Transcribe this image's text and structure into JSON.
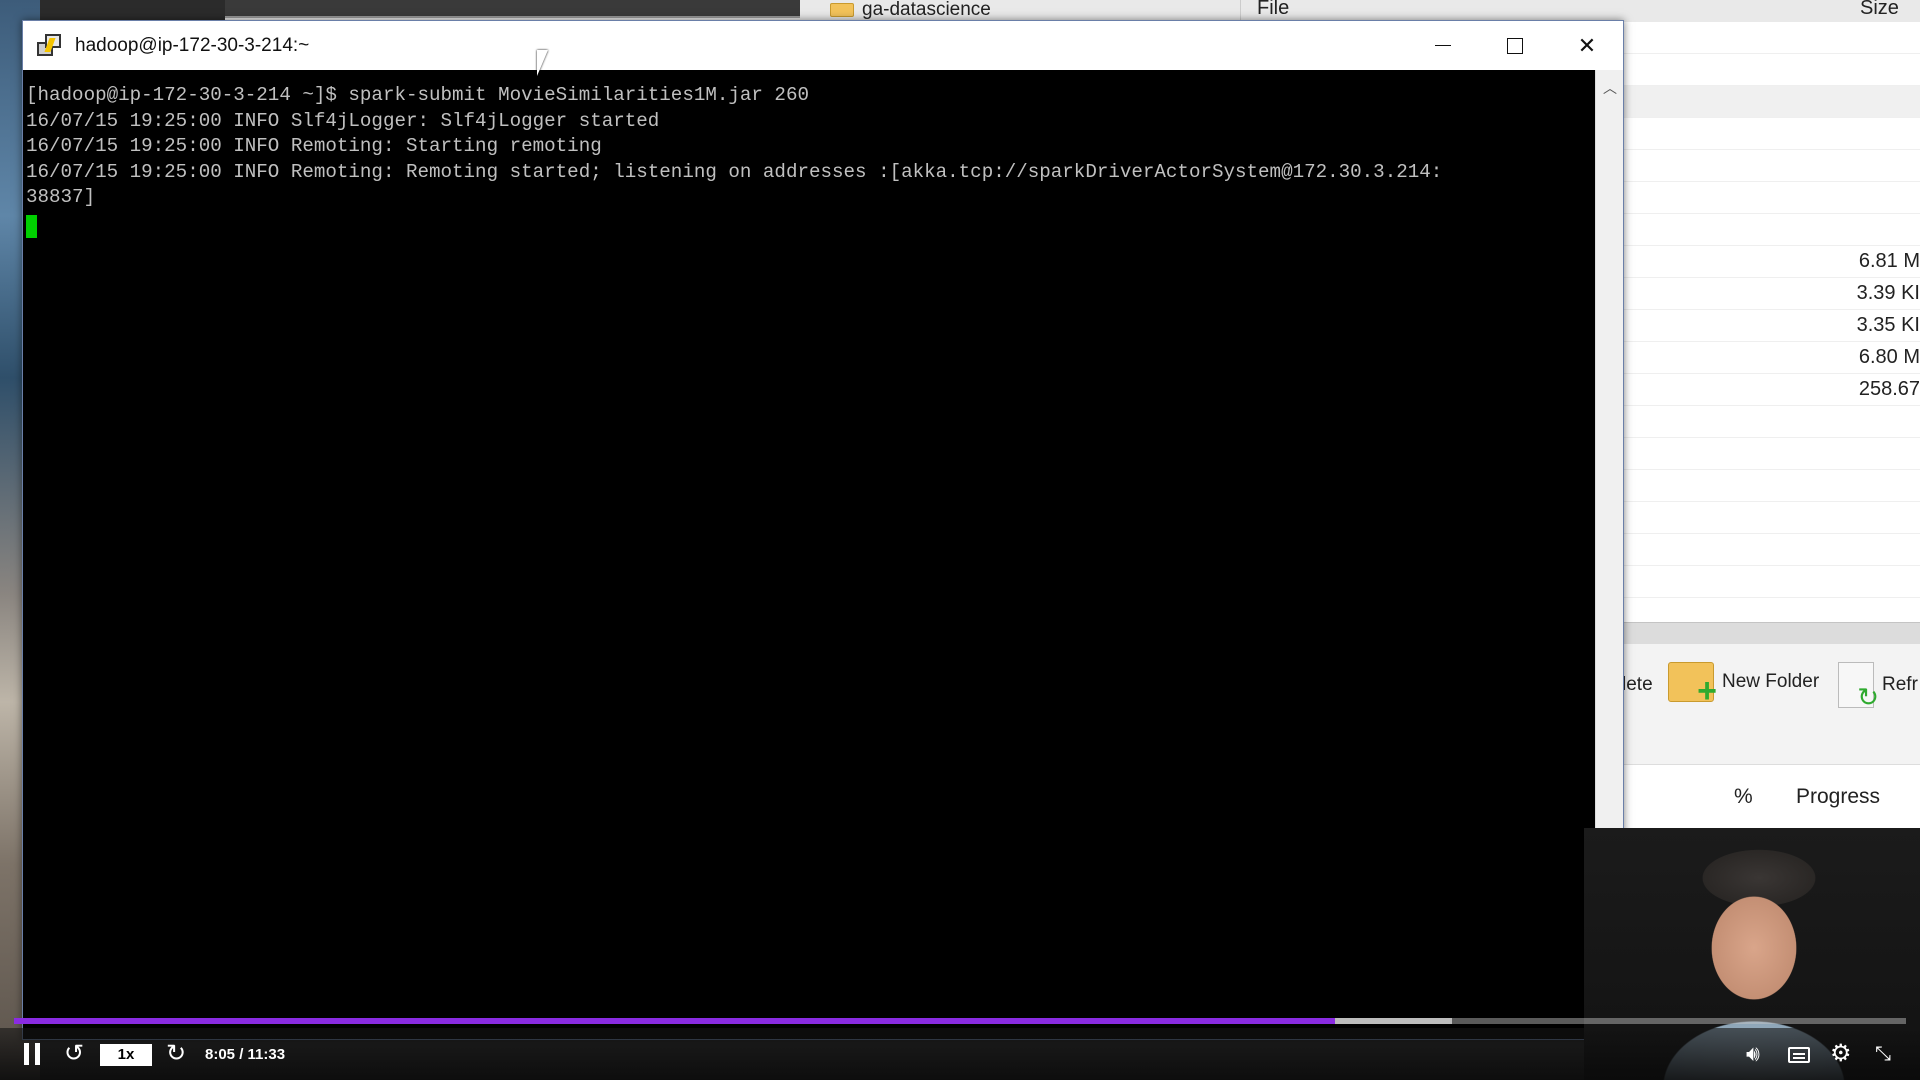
{
  "background_app": {
    "folder_label": "ga-datascience",
    "file_column_header": "File",
    "size_column_header": "Size",
    "file_sizes": [
      "6.81 M",
      "3.39 KI",
      "3.35 KI",
      "6.80 M",
      "258.67"
    ],
    "toolbar": {
      "delete_label": "lete",
      "new_folder_label": "New Folder",
      "refresh_label": "Refr"
    },
    "queue_headers": {
      "percent": "%",
      "progress": "Progress"
    }
  },
  "putty": {
    "title": "hadoop@ip-172-30-3-214:~",
    "terminal_lines": [
      "[hadoop@ip-172-30-3-214 ~]$ spark-submit MovieSimilarities1M.jar 260",
      "16/07/15 19:25:00 INFO Slf4jLogger: Slf4jLogger started",
      "16/07/15 19:25:00 INFO Remoting: Starting remoting",
      "16/07/15 19:25:00 INFO Remoting: Remoting started; listening on addresses :[akka.tcp://sparkDriverActorSystem@172.30.3.214:",
      "38837]"
    ],
    "cursor_color": "#00d000"
  },
  "player": {
    "speed_label": "1x",
    "time_display": "8:05 / 11:33",
    "progress_fraction": 0.698,
    "buffered_fraction": 0.76,
    "accent_color": "#8a2be2",
    "icons": [
      "pause-icon",
      "rewind-icon",
      "forward-icon",
      "volume-icon",
      "captions-icon",
      "gear-icon",
      "fullscreen-icon"
    ]
  }
}
